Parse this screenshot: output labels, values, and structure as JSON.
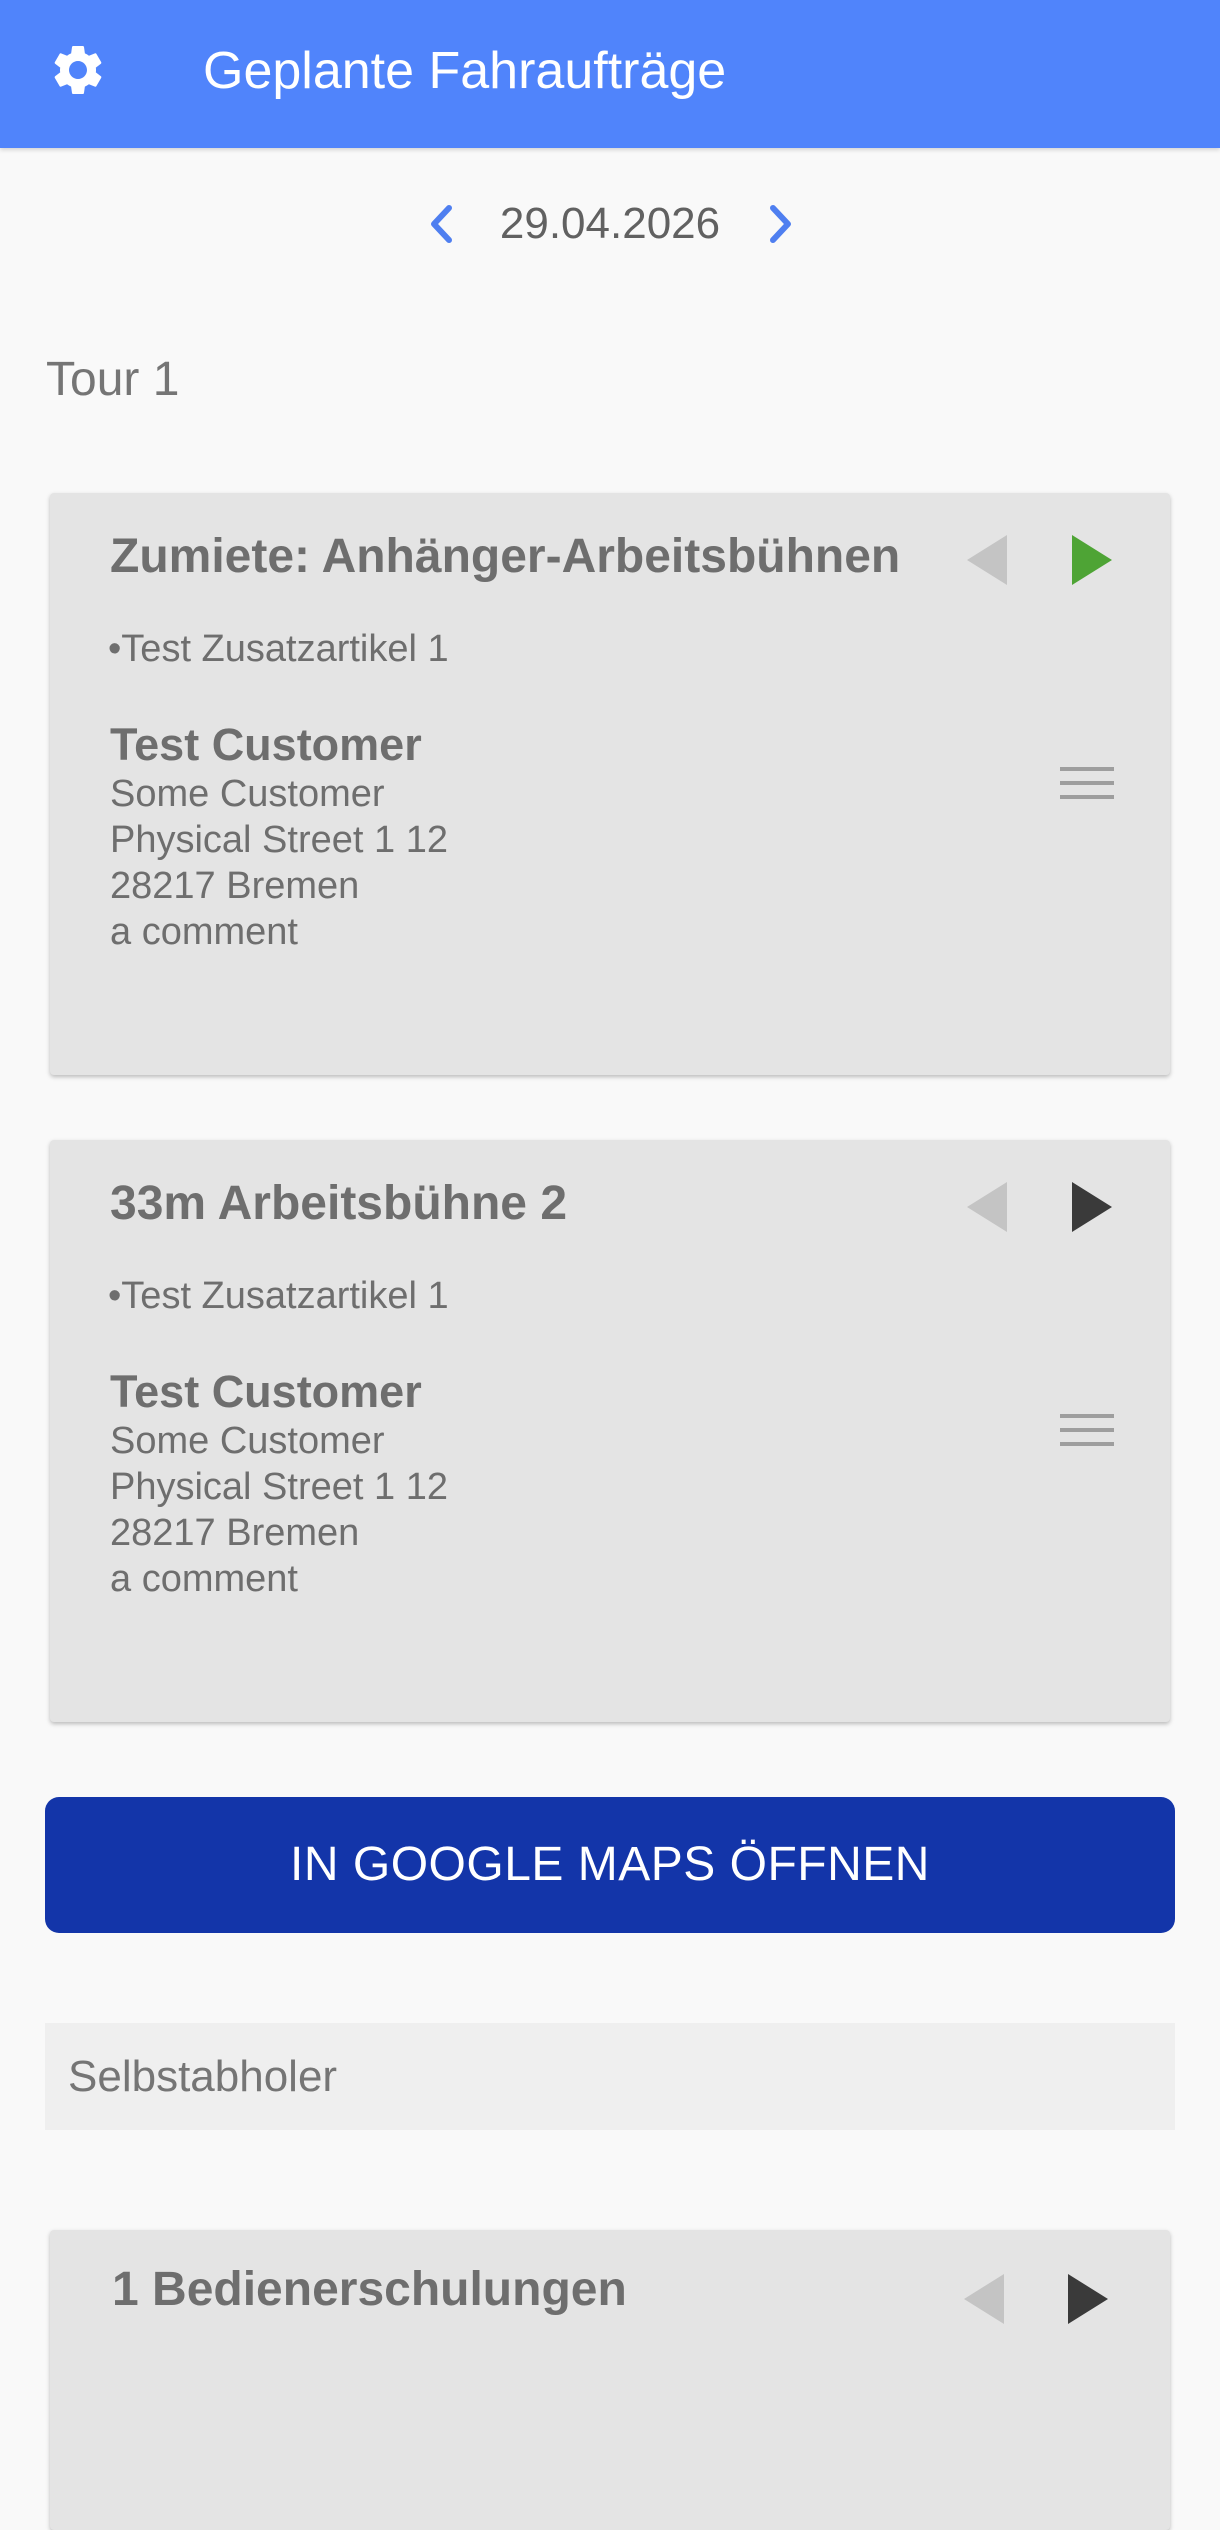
{
  "appbar": {
    "title": "Geplante Fahraufträge",
    "settings_icon": "gear-icon"
  },
  "date_nav": {
    "date": "29.04.2026",
    "prev_icon": "chevron-left-icon",
    "next_icon": "chevron-right-icon",
    "accent_color": "#4f7ff0"
  },
  "tour": {
    "title": "Tour 1",
    "orders": [
      {
        "title": "Zumiete: Anhänger-Arbeitsbühnen",
        "extra_item": "•Test Zusatzartikel 1",
        "customer_name": "Test Customer",
        "address_lines": [
          "Some Customer",
          "Physical Street 1 12",
          "28217 Bremen",
          "a comment"
        ],
        "next_color": "#4ea435",
        "status": "started"
      },
      {
        "title": "33m Arbeitsbühne 2",
        "extra_item": "•Test Zusatzartikel 1",
        "customer_name": "Test Customer",
        "address_lines": [
          "Some Customer",
          "Physical Street 1 12",
          "28217 Bremen",
          "a comment"
        ],
        "next_color": "#3a3a3a",
        "status": "pending"
      }
    ]
  },
  "maps_button": {
    "label": "IN GOOGLE MAPS ÖFFNEN",
    "color": "#1335a9"
  },
  "pickup_section": {
    "title": "Selbstabholer",
    "orders": [
      {
        "title": "1 Bedienerschulungen",
        "next_color": "#3a3a3a"
      }
    ]
  },
  "colors": {
    "appbar": "#5084fb",
    "card_bg": "#e4e4e4",
    "disabled_arrow": "#c4c4c4",
    "menu_icon": "#9e9e9e"
  }
}
